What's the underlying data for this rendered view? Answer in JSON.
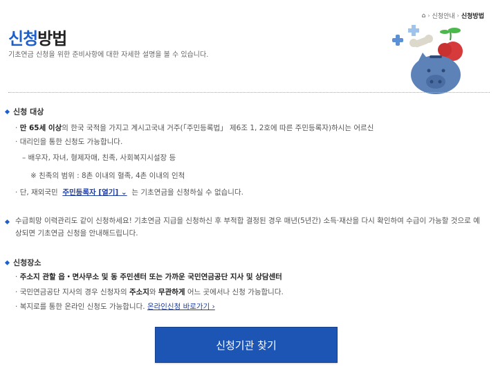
{
  "breadcrumb": {
    "home": "⌂",
    "item1": "신청안내",
    "current": "신청방법"
  },
  "title": {
    "accent": "신청",
    "rest": "방법"
  },
  "subtitle": "기초연금 신청을 위한 준비사항에 대한 자세한 설명을 볼 수 있습니다.",
  "section1": {
    "heading": "신청 대상",
    "line1_bold": "만 65세 이상",
    "line1_rest": "의 한국 국적을 가지고 계시고국내 거주(「주민등록법」 제6조 1, 2호에 따른 주민등록자)하시는 어르신",
    "line2": "대리인을 통한 신청도 가능합니다.",
    "line3": "– 배우자, 자녀, 형제자매, 친족, 사회복지시설장 등",
    "line4": "※ 친족의 범위 : 8촌 이내의 혈족, 4촌 이내의 인척",
    "line5_pre": "단, 재외국민",
    "line5_link": "주민등록자 [열기] ⌄",
    "line5_post": "는 기초연금을 신청하실 수 없습니다."
  },
  "section2": {
    "text": "수급희망 이력관리도 같이 신청하세요! 기초연금 지급을 신청하신 후 부적합 결정된 경우 매년(5년간) 소득·재산을 다시 확인하여 수급이 가능할 것으로 예상되면 기초연금 신청을 안내해드립니다."
  },
  "section3": {
    "heading": "신청장소",
    "line1": "주소지 관할 읍・면사무소 및 동 주민센터 또는 가까운 국민연금공단 지사 및 상담센터",
    "line2_pre": "국민연금공단 지사의 경우 신청자의 ",
    "line2_bold1": "주소지",
    "line2_mid": "와 ",
    "line2_bold2": "무관하게",
    "line2_post": " 어느 곳에서나 신청 가능합니다.",
    "line3_pre": "복지로를 통한 온라인 신청도 가능합니다. ",
    "line3_link": "온라인신청 바로가기 ›"
  },
  "button": {
    "label": "신청기관 찾기"
  },
  "colors": {
    "accent": "#1e5fc9",
    "button": "#1d55b5",
    "link": "#1e3fa3"
  }
}
